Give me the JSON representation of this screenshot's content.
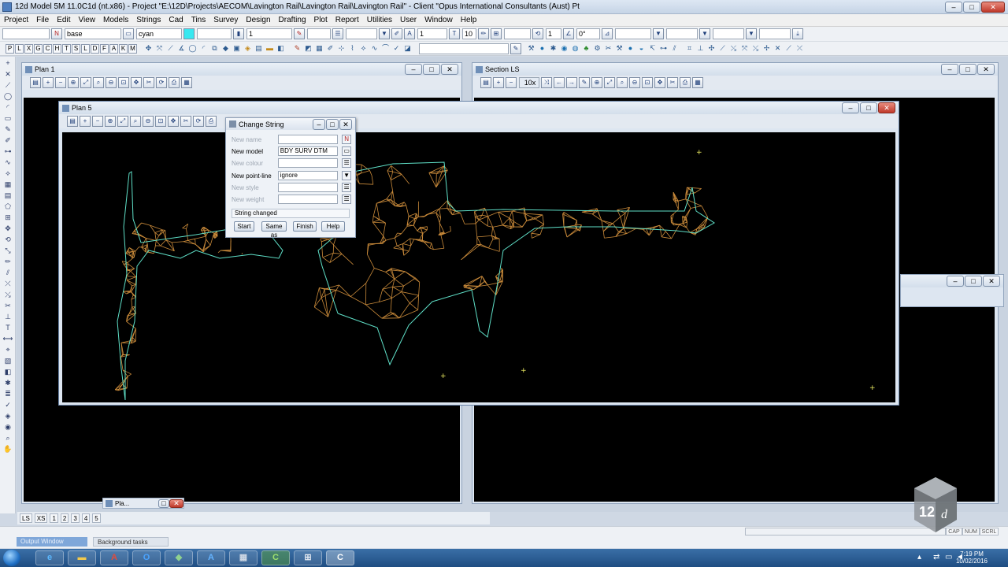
{
  "app": {
    "title": "12d Model 5M 11.0C1d (nt.x86) - Project \"E:\\12D\\Projects\\AECOM\\Lavington Rail\\Lavington Rail\\Lavington Rail\" - Client \"Opus International Consultants (Aust) Pt"
  },
  "menu": [
    "Project",
    "File",
    "Edit",
    "View",
    "Models",
    "Strings",
    "Cad",
    "Tins",
    "Survey",
    "Design",
    "Drafting",
    "Plot",
    "Report",
    "Utilities",
    "User",
    "Window",
    "Help"
  ],
  "toolbar": {
    "model": "base",
    "colour": "cyan",
    "weight": "1",
    "size_a": "1",
    "size_b": "10",
    "num": "1",
    "angle": "0°",
    "n_label": "N"
  },
  "letter_buttons": [
    "P",
    "L",
    "X",
    "G",
    "C",
    "H",
    "T",
    "S",
    "L",
    "D",
    "F",
    "A",
    "K",
    "M"
  ],
  "windows": {
    "plan1": "Plan 1",
    "section": "Section LS",
    "plan5": "Plan 5",
    "zoom": "10x"
  },
  "dialog": {
    "title": "Change String",
    "fields": [
      {
        "label": "New name",
        "value": "",
        "enabled": false,
        "btn": "N"
      },
      {
        "label": "New model",
        "value": "BDY SURV DTM",
        "enabled": true,
        "btn": "▭"
      },
      {
        "label": "New colour",
        "value": "",
        "enabled": false,
        "btn": "☰"
      },
      {
        "label": "New point-line",
        "value": "ignore",
        "enabled": true,
        "btn": "▼"
      },
      {
        "label": "New style",
        "value": "",
        "enabled": false,
        "btn": "☰"
      },
      {
        "label": "New weight",
        "value": "",
        "enabled": false,
        "btn": "☰"
      }
    ],
    "status": "String changed",
    "buttons": {
      "start": "Start",
      "same_as": "Same as",
      "finish": "Finish",
      "help": "Help"
    }
  },
  "win_tabs": [
    "LS",
    "XS",
    "1",
    "2",
    "3",
    "4",
    "5"
  ],
  "plan_tab": "Pla...",
  "output": {
    "tab1": "Output Window",
    "tab2": "Background tasks"
  },
  "status_boxes": {
    "cap": "CAP",
    "num": "NUM",
    "scrl": "SCRL"
  },
  "taskbar": {
    "time": "7:19 PM",
    "date": "10/02/2016"
  },
  "colors": {
    "tin_edges": "#c98a3a",
    "string_lines": "#5fe0c8",
    "points": "#e8e860"
  }
}
